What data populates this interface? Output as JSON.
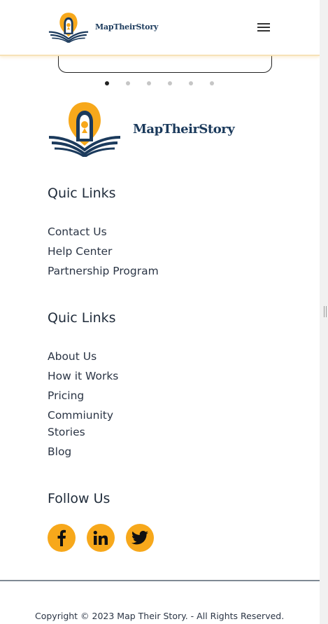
{
  "brand": {
    "name": "MapTheirStory",
    "accent": "#f7a81b",
    "navy": "#1b3a5c"
  },
  "header": {
    "logo_icon": "map-their-story-logo",
    "menu_icon": "hamburger-menu-icon"
  },
  "carousel": {
    "dot_count": 6,
    "active_index": 0
  },
  "footer": {
    "section1": {
      "title": "Quic Links",
      "links": [
        "Contact Us",
        "Help Center",
        "Partnership Program"
      ]
    },
    "section2": {
      "title": "Quic Links",
      "links": [
        "About Us",
        "How it Works",
        "Pricing",
        "Commiunity Stories",
        "Blog"
      ]
    },
    "follow": {
      "title": "Follow Us",
      "networks": [
        "facebook-icon",
        "linkedin-icon",
        "twitter-icon"
      ]
    },
    "copyright": "Copyright © 2023 Map Their Story. - All Rights Reserved."
  }
}
